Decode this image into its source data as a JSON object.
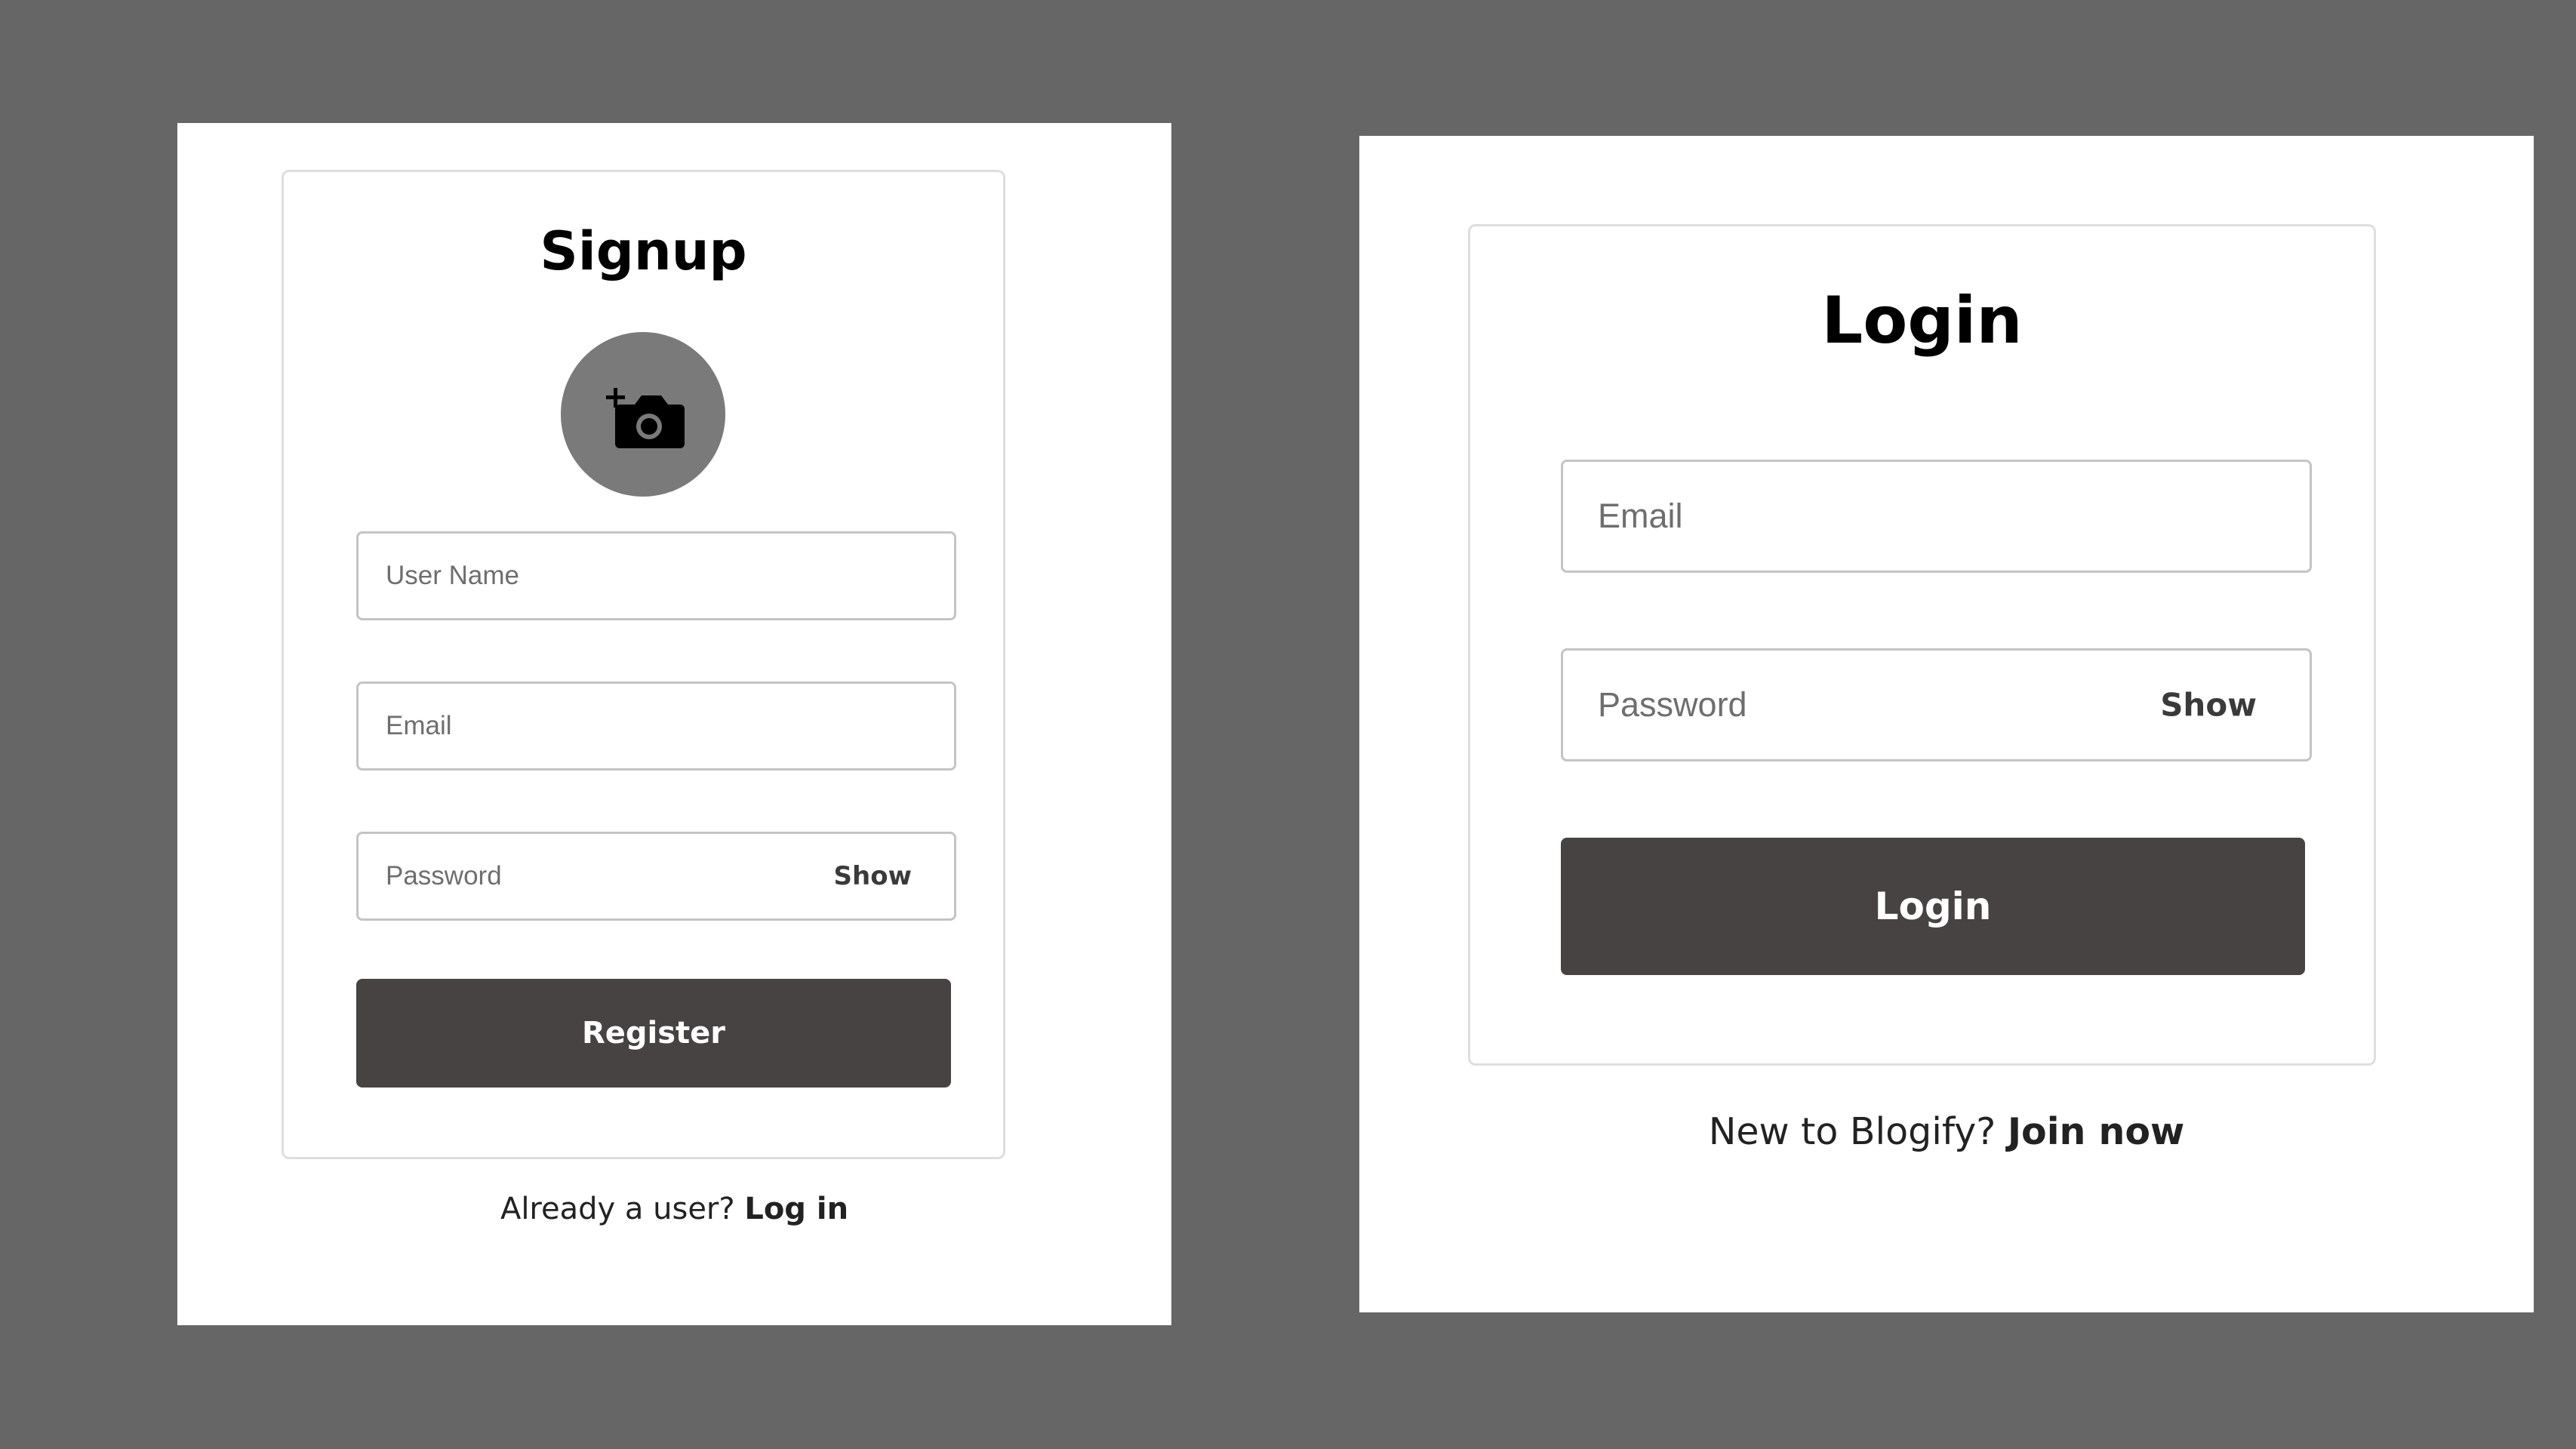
{
  "signup": {
    "title": "Signup",
    "avatar_icon": "add-photo-camera-icon",
    "username_placeholder": "User Name",
    "email_placeholder": "Email",
    "password_placeholder": "Password",
    "show_label": "Show",
    "register_label": "Register",
    "footer_text": "Already a user?",
    "footer_link": "Log in"
  },
  "login": {
    "title": "Login",
    "email_placeholder": "Email",
    "password_placeholder": "Password",
    "show_label": "Show",
    "login_label": "Login",
    "footer_text": "New to Blogify?",
    "footer_link": "Join now"
  },
  "colors": {
    "background": "#666666",
    "panel": "#ffffff",
    "button": "#474342",
    "avatar": "#7a7a7a"
  }
}
